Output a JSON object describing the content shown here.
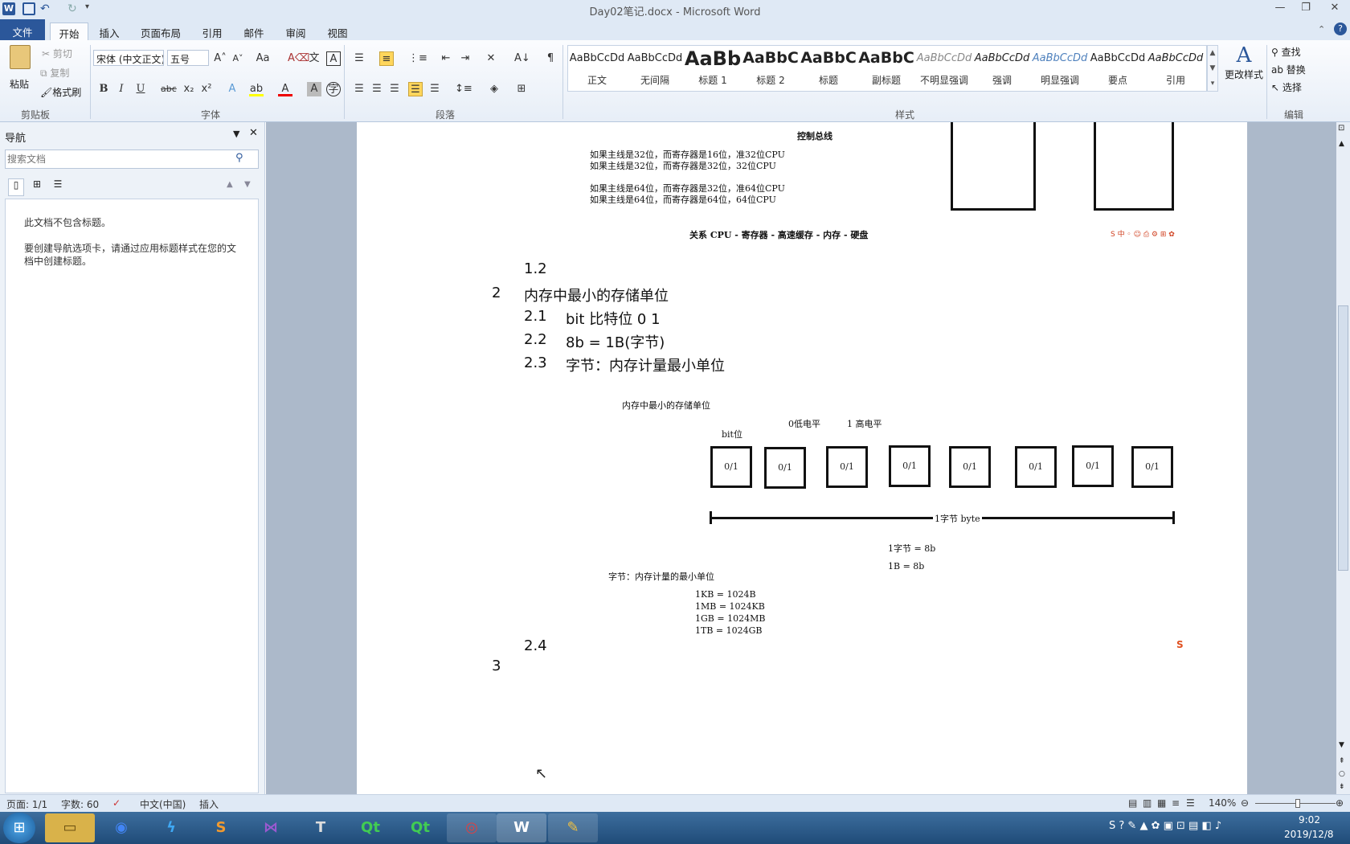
{
  "window": {
    "title": "Day02笔记.docx - Microsoft Word",
    "controls": [
      "minimize",
      "restore",
      "close"
    ]
  },
  "ribbon_tabs": [
    {
      "label": "文件",
      "active": false
    },
    {
      "label": "开始",
      "active": true
    },
    {
      "label": "插入",
      "active": false
    },
    {
      "label": "页面布局",
      "active": false
    },
    {
      "label": "引用",
      "active": false
    },
    {
      "label": "邮件",
      "active": false
    },
    {
      "label": "审阅",
      "active": false
    },
    {
      "label": "视图",
      "active": false
    }
  ],
  "clipboard": {
    "paste": "粘贴",
    "cut": "剪切",
    "copy": "复制",
    "format_painter": "格式刷",
    "group_label": "剪贴板"
  },
  "font": {
    "font_name": "宋体 (中文正文)",
    "font_size": "五号",
    "group_label": "字体"
  },
  "paragraph": {
    "group_label": "段落"
  },
  "styles": {
    "group_label": "样式",
    "change_styles": "更改样式",
    "items": [
      {
        "sample": "AaBbCcDd",
        "name": "正文"
      },
      {
        "sample": "AaBbCcDd",
        "name": "无间隔"
      },
      {
        "sample": "AaBb",
        "name": "标题 1"
      },
      {
        "sample": "AaBbC",
        "name": "标题 2"
      },
      {
        "sample": "AaBbC",
        "name": "标题"
      },
      {
        "sample": "AaBbC",
        "name": "副标题"
      },
      {
        "sample": "AaBbCcDd",
        "name": "不明显强调"
      },
      {
        "sample": "AaBbCcDd",
        "name": "强调"
      },
      {
        "sample": "AaBbCcDd",
        "name": "明显强调"
      },
      {
        "sample": "AaBbCcDd",
        "name": "要点"
      },
      {
        "sample": "AaBbCcDd",
        "name": "引用"
      }
    ]
  },
  "editing": {
    "group_label": "编辑",
    "find": "查找",
    "replace": "替换",
    "select": "选择"
  },
  "nav_pane": {
    "title": "导航",
    "search_placeholder": "搜索文档",
    "msg1": "此文档不包含标题。",
    "msg2a": "要创建导航选项卡，请通过应用标题样式在您的文",
    "msg2b": "档中创建标题。"
  },
  "document": {
    "bus_title": "控制总线",
    "bus_lines": [
      "如果主线是32位，而寄存器是16位，准32位CPU",
      "如果主线是32位，而寄存器是32位，32位CPU",
      "如果主线是64位，而寄存器是32位，准64位CPU",
      "如果主线是64位，而寄存器是64位，64位CPU"
    ],
    "relation": "关系   CPU - 寄存器 - 高速缓存 - 内存 - 硬盘",
    "outline": [
      {
        "num": "1.2",
        "text": ""
      },
      {
        "num": "2",
        "text": "内存中最小的存储单位"
      },
      {
        "num": "2.1",
        "text": "bit 比特位    0 1"
      },
      {
        "num": "2.2",
        "text": "8b = 1B(字节)"
      },
      {
        "num": "2.3",
        "text": "字节：内存计量最小单位"
      }
    ],
    "diagram": {
      "title": "内存中最小的存储单位",
      "bit_label": "bit位",
      "low_label": "0低电平",
      "high_label": "1 高电平",
      "cells": [
        "0/1",
        "0/1",
        "0/1",
        "0/1",
        "0/1",
        "0/1",
        "0/1",
        "0/1"
      ],
      "byte_label": "1字节 byte",
      "eq1": "1字节  = 8b",
      "eq2": "1B  = 8b",
      "byte_def": "字节：内存计量的最小单位",
      "units": [
        "1KB = 1024B",
        "1MB = 1024KB",
        "1GB = 1024MB",
        "1TB = 1024GB"
      ]
    },
    "after": [
      {
        "num": "2.4",
        "text": ""
      },
      {
        "num": "3",
        "text": ""
      }
    ]
  },
  "status": {
    "page": "页面: 1/1",
    "words": "字数: 60",
    "language": "中文(中国)",
    "mode": "插入",
    "zoom": "140%"
  },
  "taskbar": {
    "time": "9:02",
    "date": "2019/12/8",
    "apps": [
      "explorer",
      "chrome",
      "thunder",
      "sublime",
      "visual-studio",
      "typora",
      "qt-creator",
      "qt-designer",
      "app",
      "word",
      "paint"
    ]
  },
  "colors": {
    "file_tab": "#2b579a",
    "ribbon_bg": "#dfe9f5",
    "doc_bg": "#acb9ca",
    "taskbar": "#1f4b78"
  }
}
